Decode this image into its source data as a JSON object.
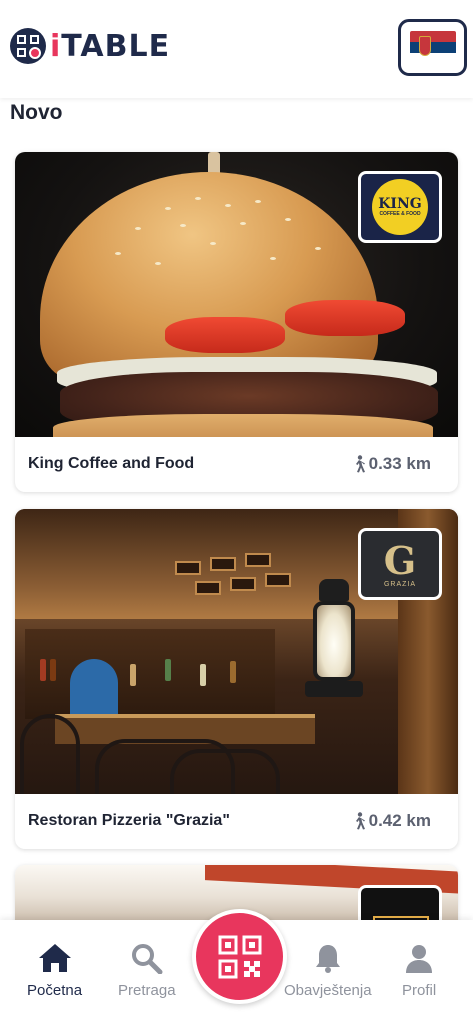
{
  "header": {
    "logo_text_i": "i",
    "logo_text_rest": "TABLE",
    "language_flag": "serbia-flag-icon"
  },
  "section": {
    "title": "Novo"
  },
  "restaurants": [
    {
      "name": "King Coffee and Food",
      "distance": "0.33 km",
      "badge_title": "KING",
      "badge_subtitle": "COFFEE & FOOD"
    },
    {
      "name": "Restoran Pizzeria \"Grazia\"",
      "distance": "0.42 km",
      "badge_title": "G",
      "badge_subtitle": "GRAZIA"
    },
    {
      "name": "",
      "distance": "",
      "badge_title": "",
      "badge_subtitle": ""
    }
  ],
  "nav": {
    "items": [
      {
        "label": "Početna",
        "icon": "home-icon",
        "active": true
      },
      {
        "label": "Pretraga",
        "icon": "search-icon",
        "active": false
      },
      {
        "label": "",
        "icon": "qr-code-icon",
        "active": false
      },
      {
        "label": "Obavještenja",
        "icon": "bell-icon",
        "active": false
      },
      {
        "label": "Profil",
        "icon": "user-icon",
        "active": false
      }
    ]
  },
  "colors": {
    "brand_navy": "#1f2a4a",
    "brand_pink": "#e8365d",
    "text_muted": "#8f939d"
  }
}
